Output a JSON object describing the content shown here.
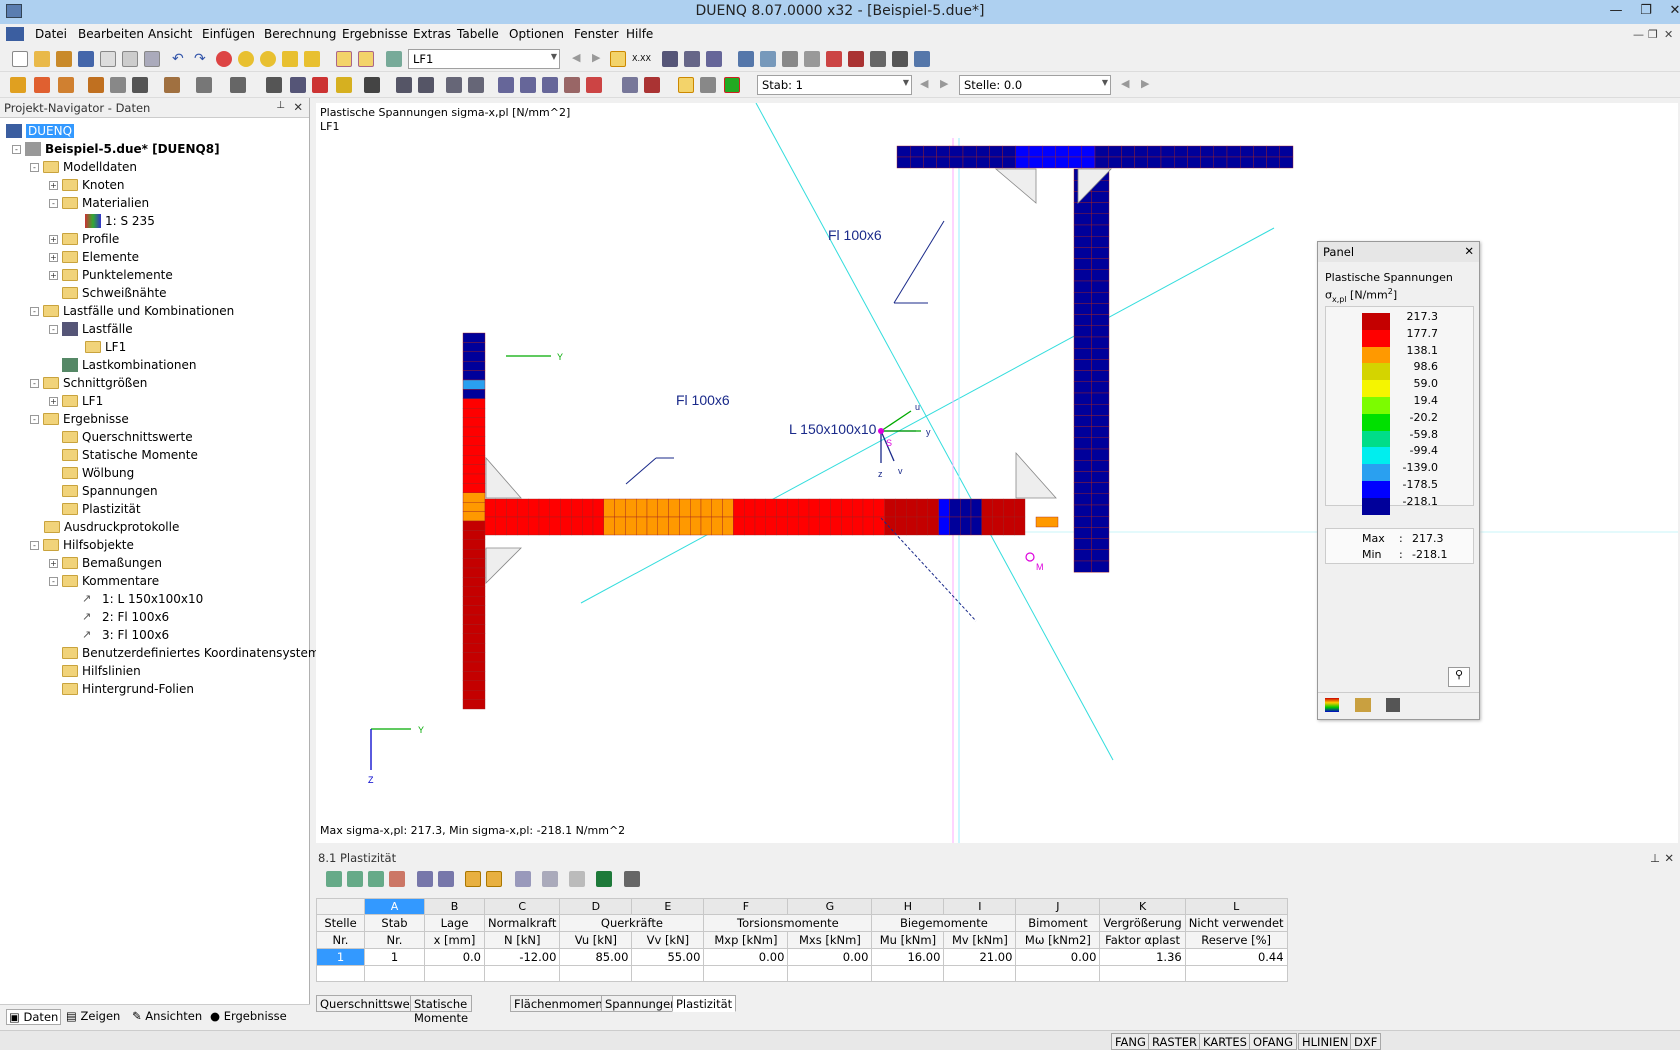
{
  "window": {
    "title": "DUENQ 8.07.0000 x32 - [Beispiel-5.due*]"
  },
  "menu": [
    "Datei",
    "Bearbeiten",
    "Ansicht",
    "Einfügen",
    "Berechnung",
    "Ergebnisse",
    "Extras",
    "Tabelle",
    "Optionen",
    "Fenster",
    "Hilfe"
  ],
  "toolbar": {
    "loadcase": "LF1",
    "stab": "Stab: 1",
    "stelle": "Stelle: 0.0",
    "xxx_icon_label": "X.XX"
  },
  "navigator": {
    "title": "Projekt-Navigator - Daten",
    "nodes": [
      "DUENQ",
      "Beispiel-5.due* [DUENQ8]",
      "Modelldaten",
      "Knoten",
      "Materialien",
      "1: S 235",
      "Profile",
      "Elemente",
      "Punktelemente",
      "Schweißnähte",
      "Lastfälle und Kombinationen",
      "Lastfälle",
      "LF1",
      "Lastkombinationen",
      "Schnittgrößen",
      "LF1",
      "Ergebnisse",
      "Querschnittswerte",
      "Statische Momente",
      "Wölbung",
      "Spannungen",
      "Plastizität",
      "Ausdruckprotokolle",
      "Hilfsobjekte",
      "Bemaßungen",
      "Kommentare",
      "1: L 150x100x10",
      "2: Fl 100x6",
      "3: Fl 100x6",
      "Benutzerdefiniertes Koordinatensystem",
      "Hilfslinien",
      "Hintergrund-Folien"
    ],
    "tabs": [
      "Daten",
      "Zeigen",
      "Ansichten",
      "Ergebnisse"
    ]
  },
  "canvas": {
    "title1": "Plastische Spannungen sigma-x,pl [N/mm^2]",
    "title2": "LF1",
    "footer": "Max sigma-x,pl: 217.3, Min sigma-x,pl: -218.1 N/mm^2",
    "labels": {
      "fl_top": "Fl 100x6",
      "fl_left": "Fl 100x6",
      "angle": "L 150x100x10",
      "axis_y": "Y",
      "axis_z": "Z",
      "u": "u",
      "v": "v",
      "y": "y",
      "z": "z",
      "s": "S",
      "m": "M"
    }
  },
  "panel": {
    "title": "Panel",
    "heading": "Plastische Spannungen",
    "unit_sym": "σ",
    "unit_sub": "x,pl",
    "unit": " [N/mm",
    "unit_sup": "2",
    "unit_end": "]",
    "legend_values": [
      "217.3",
      "177.7",
      "138.1",
      "98.6",
      "59.0",
      "19.4",
      "-20.2",
      "-59.8",
      "-99.4",
      "-139.0",
      "-178.5",
      "-218.1"
    ],
    "legend_colors": [
      "#c40000",
      "#ff0000",
      "#ff9900",
      "#d4d400",
      "#f5f500",
      "#7cfc00",
      "#00e000",
      "#00dd88",
      "#00eeee",
      "#2aa0f0",
      "#0000ff",
      "#00009a"
    ],
    "max_label": "Max",
    "max_value": "217.3",
    "min_label": "Min",
    "min_value": "-218.1",
    "sep": ":"
  },
  "results": {
    "title": "8.1 Plastizität",
    "col_letters": [
      "A",
      "B",
      "C",
      "D",
      "E",
      "F",
      "G",
      "H",
      "I",
      "J",
      "K",
      "L"
    ],
    "headers_row1": [
      "Stelle",
      "Stab",
      "Lage",
      "Normalkraft",
      "Querkräfte",
      "Torsionsmomente",
      "Biegemomente",
      "Bimoment",
      "Vergrößerung",
      "Nicht verwendet"
    ],
    "headers_row2": [
      "Nr.",
      "Nr.",
      "x [mm]",
      "N [kN]",
      "Vu [kN]",
      "Vv [kN]",
      "Mxp [kNm]",
      "Mxs [kNm]",
      "Mu [kNm]",
      "Mv [kNm]",
      "Mω [kNm2]",
      "Faktor αplast",
      "Reserve [%]"
    ],
    "row": [
      "1",
      "1",
      "0.0",
      "-12.00",
      "85.00",
      "55.00",
      "0.00",
      "0.00",
      "16.00",
      "21.00",
      "0.00",
      "1.36",
      "0.44"
    ],
    "tabs": [
      "Querschnittswerte",
      "Statische Momente",
      "Flächenmomente",
      "Spannungen",
      "Plastizität"
    ]
  },
  "status": [
    "FANG",
    "RASTER",
    "KARTES",
    "OFANG",
    "HLINIEN",
    "DXF"
  ]
}
